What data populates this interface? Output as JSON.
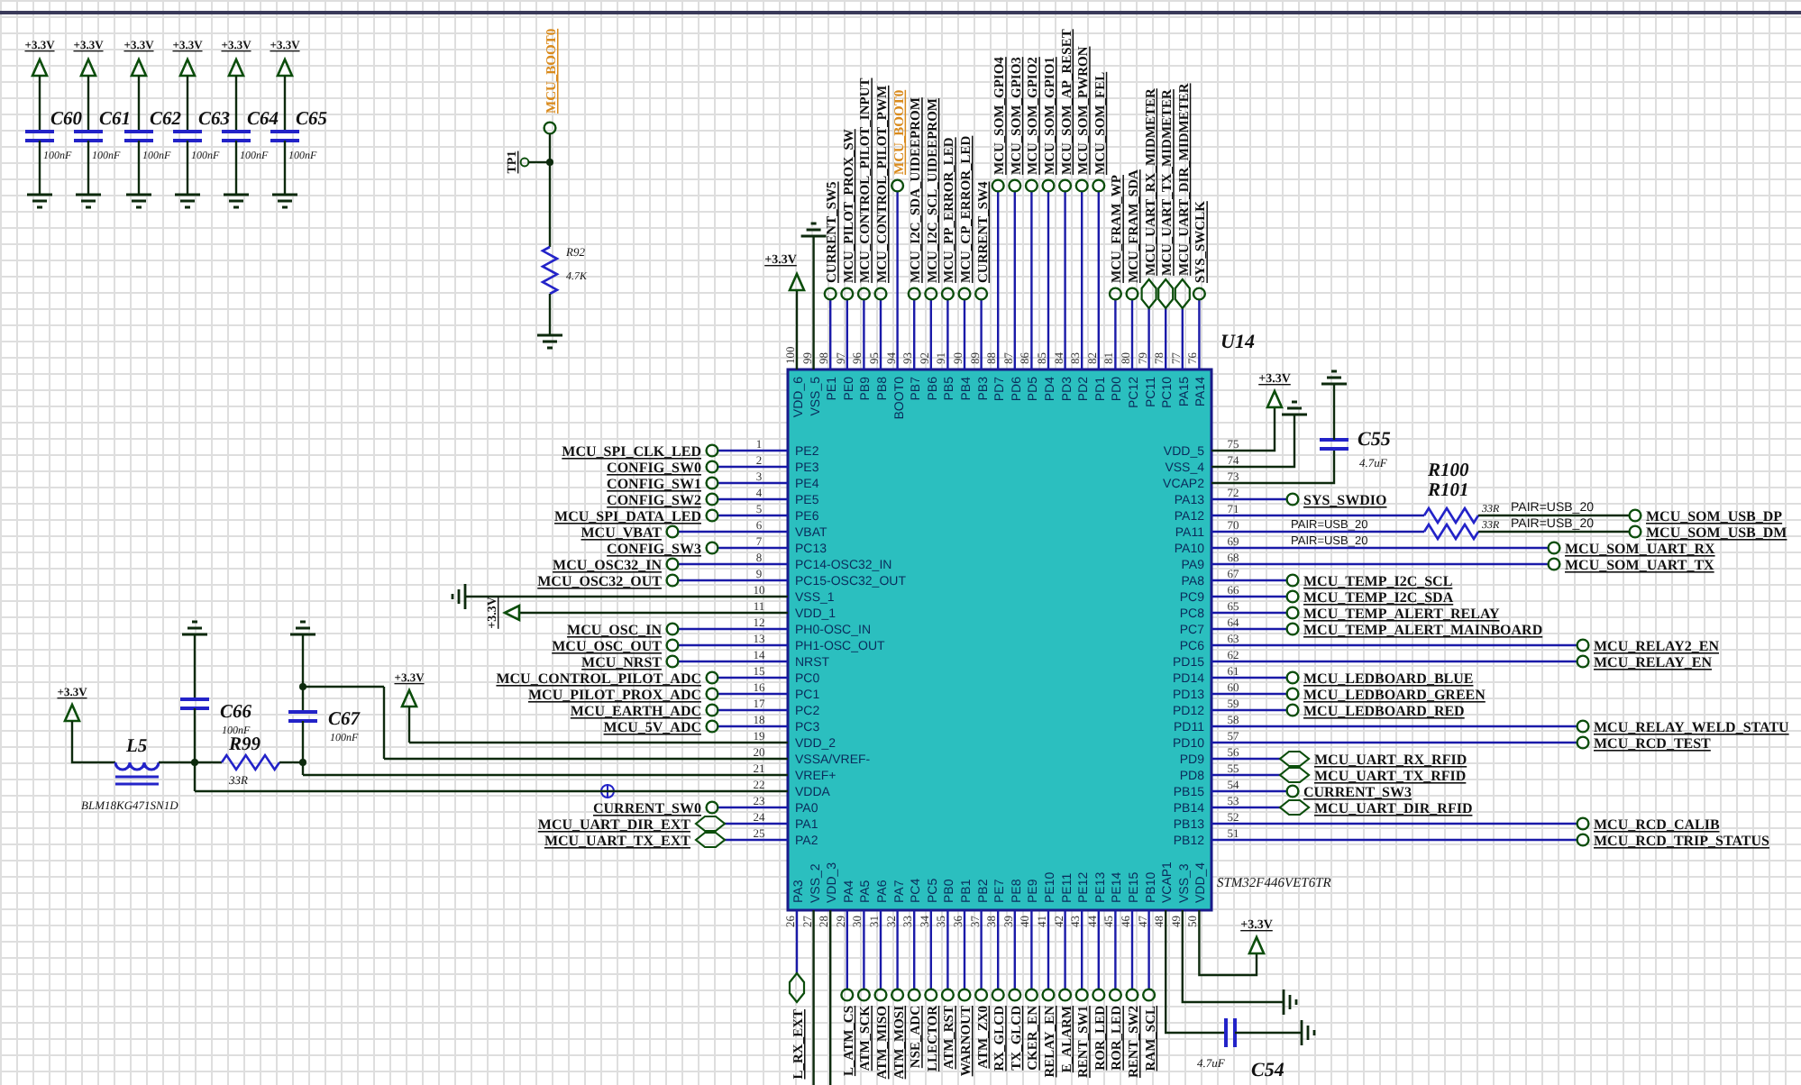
{
  "decoupling_caps": [
    {
      "ref": "C60",
      "value": "100nF",
      "supply": "+3.3V"
    },
    {
      "ref": "C61",
      "value": "100nF",
      "supply": "+3.3V"
    },
    {
      "ref": "C62",
      "value": "100nF",
      "supply": "+3.3V"
    },
    {
      "ref": "C63",
      "value": "100nF",
      "supply": "+3.3V"
    },
    {
      "ref": "C64",
      "value": "100nF",
      "supply": "+3.3V"
    },
    {
      "ref": "C65",
      "value": "100nF",
      "supply": "+3.3V"
    }
  ],
  "boot_circuit": {
    "net": "MCU_BOOT0",
    "highlighted": true,
    "test_point": "TP1",
    "resistor": {
      "ref": "R92",
      "value": "4.7K"
    }
  },
  "filter": {
    "supply_in": "+3.3V",
    "inductor": {
      "ref": "L5",
      "part": "BLM18KG471SN1D"
    },
    "cap_in": {
      "ref": "C66",
      "value": "100nF"
    },
    "resistor": {
      "ref": "R99",
      "value": "33R"
    },
    "cap_out": {
      "ref": "C67",
      "value": "100nF"
    },
    "vdd_supply": "+3.3V"
  },
  "chip": {
    "ref": "U14",
    "part": "STM32F446VET6TR",
    "left_pins": [
      {
        "number": "1",
        "name": "PE2",
        "kind": "port",
        "net": "MCU_SPI_CLK_LED"
      },
      {
        "number": "2",
        "name": "PE3",
        "kind": "port",
        "net": "CONFIG_SW0"
      },
      {
        "number": "3",
        "name": "PE4",
        "kind": "port",
        "net": "CONFIG_SW1"
      },
      {
        "number": "4",
        "name": "PE5",
        "kind": "port",
        "net": "CONFIG_SW2"
      },
      {
        "number": "5",
        "name": "PE6",
        "kind": "port",
        "net": "MCU_SPI_DATA_LED"
      },
      {
        "number": "6",
        "name": "VBAT",
        "kind": "long",
        "net": "MCU_VBAT"
      },
      {
        "number": "7",
        "name": "PC13",
        "kind": "port",
        "net": "CONFIG_SW3"
      },
      {
        "number": "8",
        "name": "PC14-OSC32_IN",
        "kind": "long",
        "net": "MCU_OSC32_IN"
      },
      {
        "number": "9",
        "name": "PC15-OSC32_OUT",
        "kind": "long",
        "net": "MCU_OSC32_OUT"
      },
      {
        "number": "10",
        "name": "VSS_1",
        "kind": "ground"
      },
      {
        "number": "11",
        "name": "VDD_1",
        "kind": "power",
        "net": "+3.3V"
      },
      {
        "number": "12",
        "name": "PH0-OSC_IN",
        "kind": "long",
        "net": "MCU_OSC_IN"
      },
      {
        "number": "13",
        "name": "PH1-OSC_OUT",
        "kind": "long",
        "net": "MCU_OSC_OUT"
      },
      {
        "number": "14",
        "name": "NRST",
        "kind": "long",
        "net": "MCU_NRST"
      },
      {
        "number": "15",
        "name": "PC0",
        "kind": "port",
        "net": "MCU_CONTROL_PILOT_ADC"
      },
      {
        "number": "16",
        "name": "PC1",
        "kind": "port",
        "net": "MCU_PILOT_PROX_ADC"
      },
      {
        "number": "17",
        "name": "PC2",
        "kind": "port",
        "net": "MCU_EARTH_ADC"
      },
      {
        "number": "18",
        "name": "PC3",
        "kind": "port",
        "net": "MCU_5V_ADC"
      },
      {
        "number": "19",
        "name": "VDD_2",
        "kind": "wire"
      },
      {
        "number": "20",
        "name": "VSSA/VREF-",
        "kind": "wire"
      },
      {
        "number": "21",
        "name": "VREF+",
        "kind": "wire"
      },
      {
        "number": "22",
        "name": "VDDA",
        "kind": "wire"
      },
      {
        "number": "23",
        "name": "PA0",
        "kind": "port",
        "net": "CURRENT_SW0"
      },
      {
        "number": "24",
        "name": "PA1",
        "kind": "bidir",
        "net": "MCU_UART_DIR_EXT"
      },
      {
        "number": "25",
        "name": "PA2",
        "kind": "bidir",
        "net": "MCU_UART_TX_EXT"
      }
    ],
    "right_pins": [
      {
        "number": "75",
        "name": "VDD_5",
        "kind": "power",
        "net": "+3.3V"
      },
      {
        "number": "74",
        "name": "VSS_4",
        "kind": "ground"
      },
      {
        "number": "73",
        "name": "VCAP2",
        "kind": "cap",
        "cap": {
          "ref": "C55",
          "value": "4.7uF"
        }
      },
      {
        "number": "72",
        "name": "PA13",
        "kind": "port",
        "net": "SYS_SWDIO"
      },
      {
        "number": "71",
        "name": "PA12",
        "kind": "series",
        "net": "MCU_SOM_USB_DP",
        "resistor": {
          "ref": "R100",
          "value": "33R"
        },
        "pair_left": "PAIR=USB_20",
        "pair_right": "PAIR=USB_20"
      },
      {
        "number": "70",
        "name": "PA11",
        "kind": "series",
        "net": "MCU_SOM_USB_DM",
        "resistor": {
          "ref": "R101",
          "value": "33R"
        },
        "pair_left": "PAIR=USB_20",
        "pair_right": "PAIR=USB_20"
      },
      {
        "number": "69",
        "name": "PA10",
        "kind": "mid",
        "net": "MCU_SOM_UART_RX"
      },
      {
        "number": "68",
        "name": "PA9",
        "kind": "mid",
        "net": "MCU_SOM_UART_TX"
      },
      {
        "number": "67",
        "name": "PA8",
        "kind": "port",
        "net": "MCU_TEMP_I2C_SCL"
      },
      {
        "number": "66",
        "name": "PC9",
        "kind": "port",
        "net": "MCU_TEMP_I2C_SDA"
      },
      {
        "number": "65",
        "name": "PC8",
        "kind": "port",
        "net": "MCU_TEMP_ALERT_RELAY"
      },
      {
        "number": "64",
        "name": "PC7",
        "kind": "port",
        "net": "MCU_TEMP_ALERT_MAINBOARD"
      },
      {
        "number": "63",
        "name": "PC6",
        "kind": "long",
        "net": "MCU_RELAY2_EN"
      },
      {
        "number": "62",
        "name": "PD15",
        "kind": "long",
        "net": "MCU_RELAY_EN"
      },
      {
        "number": "61",
        "name": "PD14",
        "kind": "port",
        "net": "MCU_LEDBOARD_BLUE"
      },
      {
        "number": "60",
        "name": "PD13",
        "kind": "port",
        "net": "MCU_LEDBOARD_GREEN"
      },
      {
        "number": "59",
        "name": "PD12",
        "kind": "port",
        "net": "MCU_LEDBOARD_RED"
      },
      {
        "number": "58",
        "name": "PD11",
        "kind": "long",
        "net": "MCU_RELAY_WELD_STATU"
      },
      {
        "number": "57",
        "name": "PD10",
        "kind": "long",
        "net": "MCU_RCD_TEST"
      },
      {
        "number": "56",
        "name": "PD9",
        "kind": "bidir",
        "net": "MCU_UART_RX_RFID"
      },
      {
        "number": "55",
        "name": "PD8",
        "kind": "bidir",
        "net": "MCU_UART_TX_RFID"
      },
      {
        "number": "54",
        "name": "PB15",
        "kind": "port",
        "net": "CURRENT_SW3"
      },
      {
        "number": "53",
        "name": "PB14",
        "kind": "bidir",
        "net": "MCU_UART_DIR_RFID"
      },
      {
        "number": "52",
        "name": "PB13",
        "kind": "long",
        "net": "MCU_RCD_CALIB"
      },
      {
        "number": "51",
        "name": "PB12",
        "kind": "long",
        "net": "MCU_RCD_TRIP_STATUS"
      }
    ],
    "top_pins": [
      {
        "number": "100",
        "name": "VDD_6",
        "kind": "power",
        "net": "+3.3V"
      },
      {
        "number": "99",
        "name": "VSS_5",
        "kind": "ground"
      },
      {
        "number": "98",
        "name": "PE1",
        "kind": "port",
        "net": "CURRENT_SW5"
      },
      {
        "number": "97",
        "name": "PE0",
        "kind": "port",
        "net": "MCU_PILOT_PROX_SW"
      },
      {
        "number": "96",
        "name": "PB9",
        "kind": "port",
        "net": "MCU_CONTROL_PILOT_INPUT"
      },
      {
        "number": "95",
        "name": "PB8",
        "kind": "port",
        "net": "MCU_CONTROL_PILOT_PWM"
      },
      {
        "number": "94",
        "name": "BOOT0",
        "kind": "long",
        "net": "MCU_BOOT0",
        "highlighted": true
      },
      {
        "number": "93",
        "name": "PB7",
        "kind": "port",
        "net": "MCU_I2C_SDA_UIDEEPROM"
      },
      {
        "number": "92",
        "name": "PB6",
        "kind": "port",
        "net": "MCU_I2C_SCL_UIDEEPROM"
      },
      {
        "number": "91",
        "name": "PB5",
        "kind": "port",
        "net": "MCU_PP_ERROR_LED"
      },
      {
        "number": "90",
        "name": "PB4",
        "kind": "port",
        "net": "MCU_CP_ERROR_LED"
      },
      {
        "number": "89",
        "name": "PB3",
        "kind": "port",
        "net": "CURRENT_SW4"
      },
      {
        "number": "88",
        "name": "PD7",
        "kind": "long",
        "net": "MCU_SOM_GPIO4"
      },
      {
        "number": "87",
        "name": "PD6",
        "kind": "long",
        "net": "MCU_SOM_GPIO3"
      },
      {
        "number": "86",
        "name": "PD5",
        "kind": "long",
        "net": "MCU_SOM_GPIO2"
      },
      {
        "number": "85",
        "name": "PD4",
        "kind": "long",
        "net": "MCU_SOM_GPIO1"
      },
      {
        "number": "84",
        "name": "PD3",
        "kind": "long",
        "net": "MCU_SOM_AP_RESET"
      },
      {
        "number": "83",
        "name": "PD2",
        "kind": "long",
        "net": "MCU_SOM_PWRON"
      },
      {
        "number": "82",
        "name": "PD1",
        "kind": "long",
        "net": "MCU_SOM_FEL"
      },
      {
        "number": "81",
        "name": "PD0",
        "kind": "port",
        "net": "MCU_FRAM_WP"
      },
      {
        "number": "80",
        "name": "PC12",
        "kind": "port",
        "net": "MCU_FRAM_SDA"
      },
      {
        "number": "79",
        "name": "PC11",
        "kind": "bidir",
        "net": "MCU_UART_RX_MIDMETER"
      },
      {
        "number": "78",
        "name": "PC10",
        "kind": "bidir",
        "net": "MCU_UART_TX_MIDMETER"
      },
      {
        "number": "77",
        "name": "PA15",
        "kind": "bidir",
        "net": "MCU_UART_DIR_MIDMETER"
      },
      {
        "number": "76",
        "name": "PA14",
        "kind": "port",
        "net": "SYS_SWCLK"
      }
    ],
    "bottom_pins": [
      {
        "number": "26",
        "name": "PA3",
        "kind": "bidir",
        "net": "L_RX_EXT"
      },
      {
        "number": "27",
        "name": "VSS_2",
        "kind": "wire"
      },
      {
        "number": "28",
        "name": "VDD_3",
        "kind": "wire"
      },
      {
        "number": "29",
        "name": "PA4",
        "kind": "port",
        "net": "L_ATM_CS"
      },
      {
        "number": "30",
        "name": "PA5",
        "kind": "port",
        "net": "ATM_SCK"
      },
      {
        "number": "31",
        "name": "PA6",
        "kind": "port",
        "net": "ATM_MISO"
      },
      {
        "number": "32",
        "name": "PA7",
        "kind": "port",
        "net": "ATM_MOSI"
      },
      {
        "number": "33",
        "name": "PC4",
        "kind": "port",
        "net": "NSE_ADC"
      },
      {
        "number": "34",
        "name": "PC5",
        "kind": "port",
        "net": "LLECTOR"
      },
      {
        "number": "35",
        "name": "PB0",
        "kind": "port",
        "net": "ATM_RST"
      },
      {
        "number": "36",
        "name": "PB1",
        "kind": "port",
        "net": "WARNOUT"
      },
      {
        "number": "37",
        "name": "PB2",
        "kind": "port",
        "net": "ATM_ZX0"
      },
      {
        "number": "38",
        "name": "PE7",
        "kind": "port",
        "net": "RX_GLCD"
      },
      {
        "number": "39",
        "name": "PE8",
        "kind": "port",
        "net": "TX_GLCD"
      },
      {
        "number": "40",
        "name": "PE9",
        "kind": "port",
        "net": "CKER_EN"
      },
      {
        "number": "41",
        "name": "PE10",
        "kind": "port",
        "net": "RELAY_EN"
      },
      {
        "number": "42",
        "name": "PE11",
        "kind": "port",
        "net": "E_ALARM"
      },
      {
        "number": "43",
        "name": "PE12",
        "kind": "port",
        "net": "RENT_SW1"
      },
      {
        "number": "44",
        "name": "PE13",
        "kind": "port",
        "net": "ROR_LED"
      },
      {
        "number": "45",
        "name": "PE14",
        "kind": "port",
        "net": "ROR_LED"
      },
      {
        "number": "46",
        "name": "PE15",
        "kind": "port",
        "net": "RENT_SW2"
      },
      {
        "number": "47",
        "name": "PB10",
        "kind": "port",
        "net": "RAM_SCL"
      },
      {
        "number": "48",
        "name": "VCAP1",
        "kind": "cap",
        "cap": {
          "ref": "C54",
          "value": "4.7uF"
        }
      },
      {
        "number": "49",
        "name": "VSS_3",
        "kind": "ground"
      },
      {
        "number": "50",
        "name": "VDD_4",
        "kind": "power",
        "net": "+3.3V"
      }
    ]
  }
}
